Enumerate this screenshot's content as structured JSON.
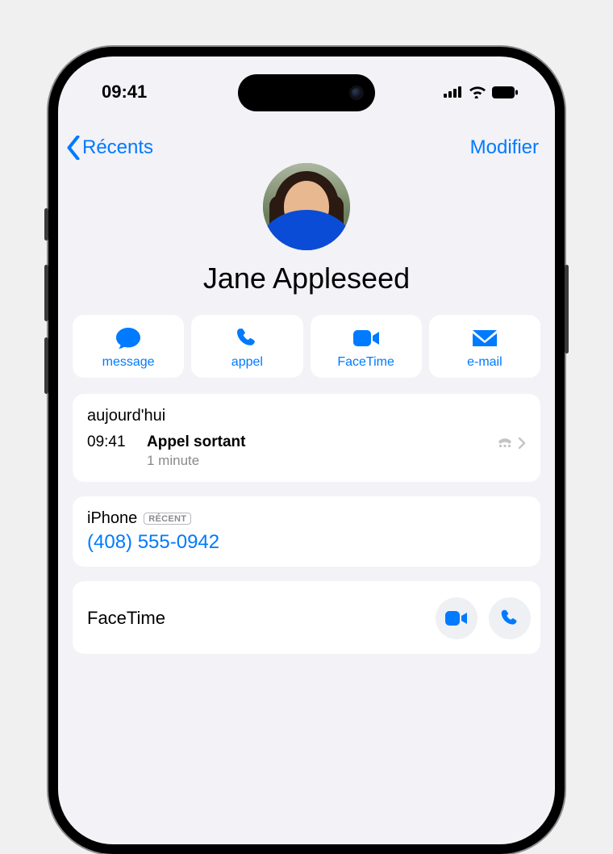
{
  "status": {
    "time": "09:41"
  },
  "nav": {
    "back": "Récents",
    "edit": "Modifier"
  },
  "contact": {
    "name": "Jane Appleseed"
  },
  "actions": {
    "message": "message",
    "call": "appel",
    "facetime": "FaceTime",
    "email": "e-mail"
  },
  "log": {
    "section": "aujourd'hui",
    "time": "09:41",
    "type": "Appel sortant",
    "duration": "1 minute"
  },
  "phone": {
    "label": "iPhone",
    "badge": "RÉCENT",
    "number": "(408) 555-0942"
  },
  "facetime": {
    "label": "FaceTime"
  },
  "colors": {
    "primary": "#007aff"
  }
}
